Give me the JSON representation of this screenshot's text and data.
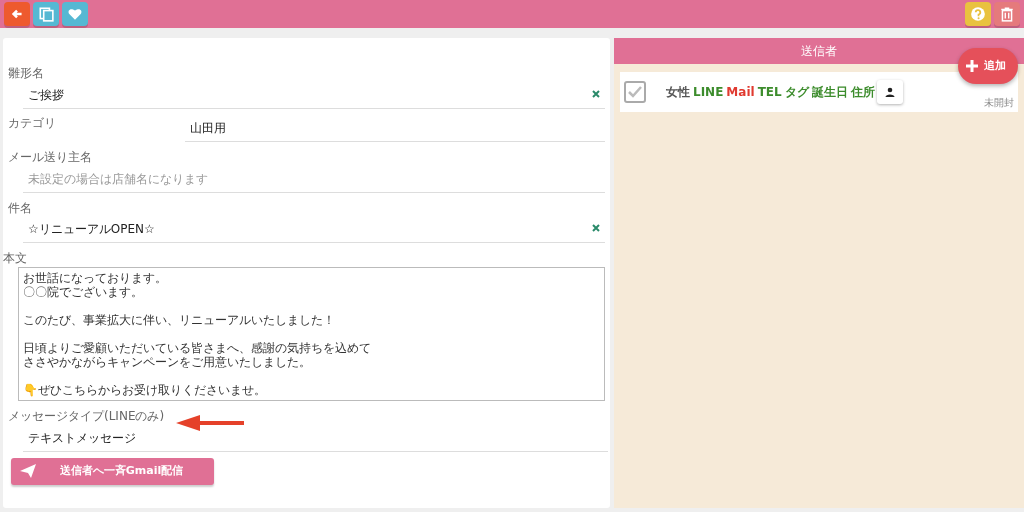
{
  "toolbar": {
    "left_buttons": [
      {
        "kind": "back",
        "color": "#ee5a2e"
      },
      {
        "kind": "copy",
        "color": "#56b8d3"
      },
      {
        "kind": "favorite",
        "color": "#56b8d3"
      }
    ],
    "right_buttons": [
      {
        "kind": "help",
        "color": "#e9c23f"
      },
      {
        "kind": "delete",
        "color": "#e57a7c"
      }
    ]
  },
  "form": {
    "fields": [
      {
        "kind": "text",
        "label": "雛形名",
        "value": "ご挨拶",
        "clearable": true
      },
      {
        "kind": "inline",
        "label": "カテゴリ",
        "value": "山田用",
        "clearable": false
      },
      {
        "kind": "text",
        "label": "メール送り主名",
        "placeholder": "未設定の場合は店舗名になります",
        "clearable": false
      },
      {
        "kind": "text",
        "label": "件名",
        "value": "☆リニューアルOPEN☆",
        "clearable": true
      },
      {
        "kind": "textarea",
        "label": "本文",
        "paragraphs": [
          [
            "お世話になっております。",
            "〇〇院でございます。"
          ],
          [
            "このたび、事業拡大に伴い、リニューアルいたしました！"
          ],
          [
            "日頃よりご愛顧いただいている皆さまへ、感謝の気持ちを込めて",
            "ささやかながらキャンペーンをご用意いたしました。"
          ],
          [
            "👇ぜひこちらからお受け取りくださいませ。"
          ]
        ]
      },
      {
        "kind": "select",
        "label": "メッセージタイプ(LINEのみ)",
        "value": "テキストメッセージ",
        "clearable": false
      }
    ],
    "submit_button": "送信者へ一斉Gmail配信"
  },
  "senders": {
    "title": "送信者",
    "add_button": "追加",
    "rows": [
      {
        "checked": true,
        "status": "未開封",
        "tags": [
          {
            "label": "女性",
            "color": "#555555"
          },
          {
            "label": "LINE",
            "color": "#3c8c2c"
          },
          {
            "label": "Mail",
            "color": "#e03a30"
          },
          {
            "label": "TEL",
            "color": "#3c8c2c"
          },
          {
            "label": "タグ",
            "color": "#3c8c2c"
          },
          {
            "label": "誕生日",
            "color": "#3c8c2c"
          },
          {
            "label": "住所",
            "color": "#3c8c2c"
          }
        ]
      }
    ]
  }
}
